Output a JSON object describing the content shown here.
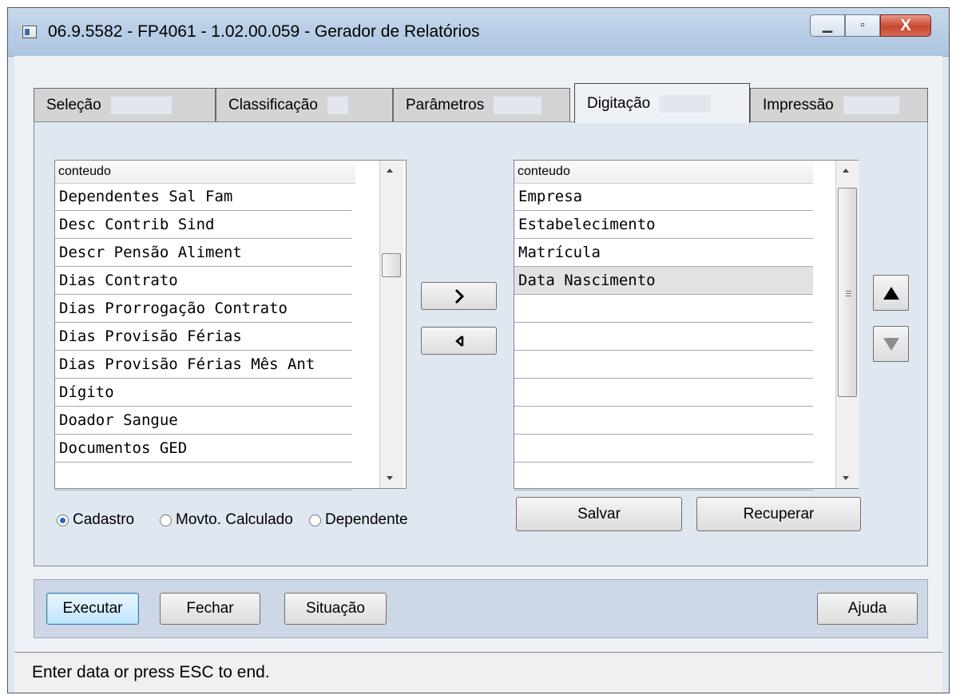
{
  "window": {
    "title": "06.9.5582 - FP4061 - 1.02.00.059 - Gerador de Relatórios",
    "close_label": "X"
  },
  "tabs": [
    {
      "label": "Seleção"
    },
    {
      "label": "Classificação"
    },
    {
      "label": "Parâmetros"
    },
    {
      "label": "Digitação"
    },
    {
      "label": "Impressão"
    }
  ],
  "left_list": {
    "header": "conteudo",
    "rows": [
      "Dependentes Sal Fam",
      "Desc Contrib Sind",
      "Descr Pensão Aliment",
      "Dias Contrato",
      "Dias Prorrogação Contrato",
      "Dias Provisão Férias",
      "Dias Provisão Férias Mês Ant",
      "Dígito",
      "Doador Sangue",
      "Documentos GED",
      ""
    ]
  },
  "right_list": {
    "header": "conteudo",
    "rows": [
      "Empresa",
      "Estabelecimento",
      "Matrícula",
      "Data Nascimento",
      "",
      "",
      "",
      "",
      "",
      "",
      ""
    ],
    "selected_index": 3
  },
  "radios": [
    {
      "label": "Cadastro",
      "checked": true
    },
    {
      "label": "Movto. Calculado",
      "checked": false
    },
    {
      "label": "Dependente",
      "checked": false
    }
  ],
  "buttons": {
    "salvar": "Salvar",
    "recuperar": "Recuperar",
    "executar": "Executar",
    "fechar": "Fechar",
    "situacao": "Situação",
    "ajuda": "Ajuda"
  },
  "status": "Enter data or press ESC to end.",
  "colors": {
    "title_bar": "#b8cde6",
    "close_button": "#c8462f",
    "default_button": "#bee6fd"
  }
}
